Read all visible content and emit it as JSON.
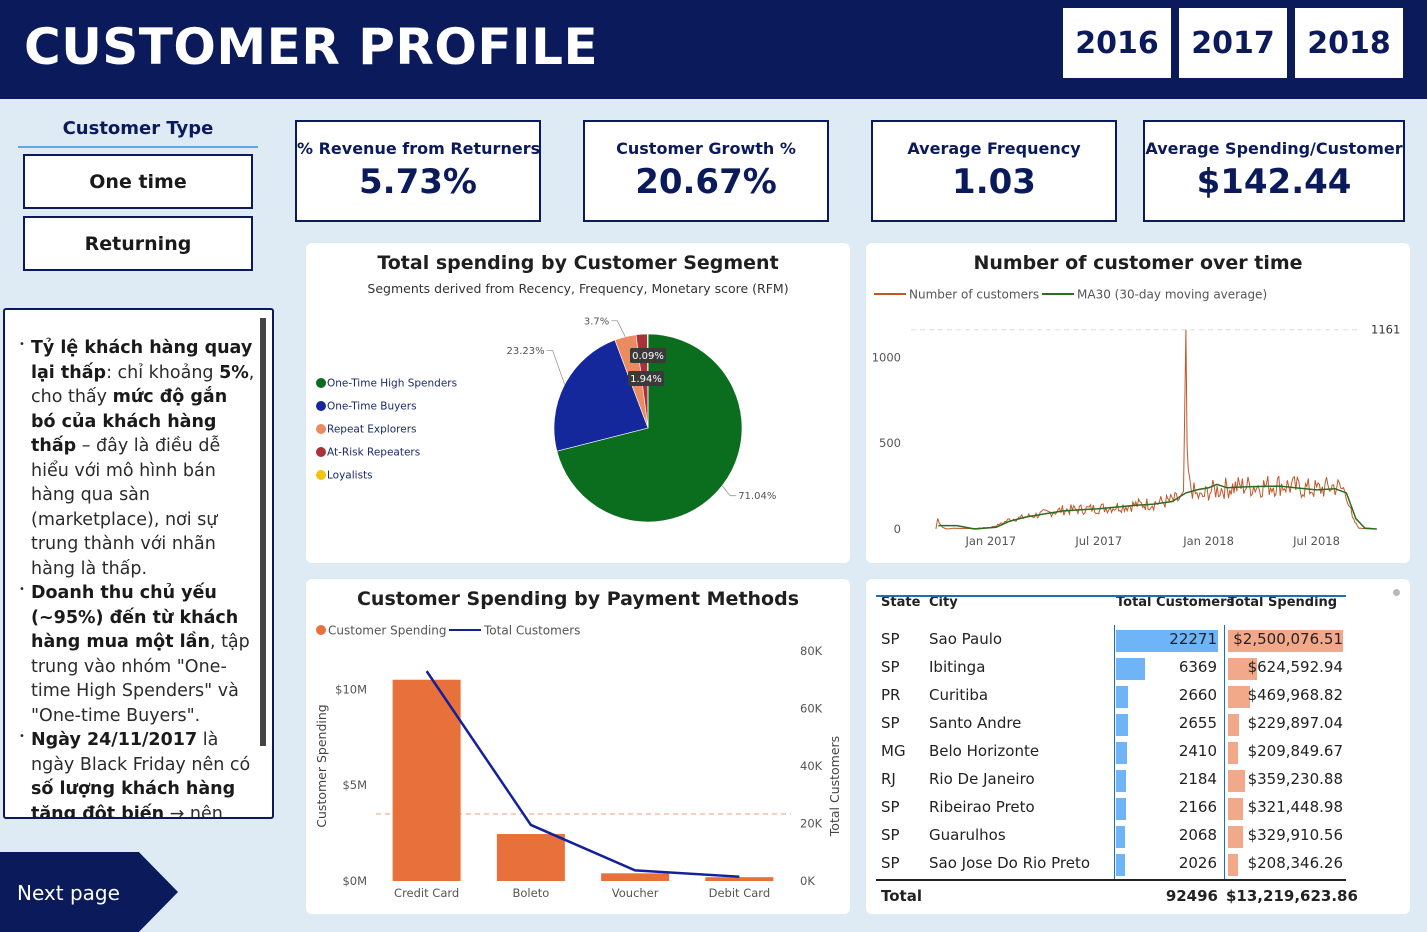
{
  "header": {
    "title": "CUSTOMER PROFILE",
    "years": [
      "2016",
      "2017",
      "2018"
    ]
  },
  "customer_type": {
    "title": "Customer Type",
    "options": [
      "One time",
      "Returning"
    ]
  },
  "kpis": [
    {
      "label": "% Revenue from Returners",
      "value": "5.73%"
    },
    {
      "label": "Customer Growth %",
      "value": "20.67%"
    },
    {
      "label": "Average Frequency",
      "value": "1.03"
    },
    {
      "label": "Average Spending/Customer",
      "value": "$142.44"
    }
  ],
  "notes": [
    {
      "parts": [
        [
          "b",
          "Tỷ lệ khách hàng quay lại thấp"
        ],
        [
          "t",
          ": chỉ khoảng "
        ],
        [
          "b",
          "5%"
        ],
        [
          "t",
          ", cho thấy "
        ],
        [
          "b",
          "mức độ gắn bó của khách hàng thấp"
        ],
        [
          "t",
          " – đây là điều dễ hiểu với mô hình bán hàng qua sàn (marketplace), nơi sự trung thành với nhãn hàng là thấp."
        ]
      ]
    },
    {
      "parts": [
        [
          "b",
          "Doanh thu chủ yếu (~95%) đến từ khách hàng mua một lần"
        ],
        [
          "t",
          ", tập trung vào nhóm \"One-time High Spenders\" và \"One-time Buyers\"."
        ]
      ]
    },
    {
      "parts": [
        [
          "b",
          "Ngày 24/11/2017"
        ],
        [
          "t",
          " là ngày Black Friday nên có "
        ],
        [
          "b",
          "số lượng khách hàng tăng đột biến"
        ],
        [
          "t",
          " → nên tận dụng các sự kiện mua sắm lớn."
        ]
      ]
    }
  ],
  "next_page": "Next page",
  "segment_chart": {
    "title": "Total spending by Customer Segment",
    "subtitle": "Segments derived from Recency, Frequency, Monetary score (RFM)",
    "chart_data": {
      "type": "pie",
      "title": "Total spending by Customer Segment",
      "subtitle": "Segments derived from Recency, Frequency, Monetary score (RFM)",
      "legend_position": "left",
      "slices": [
        {
          "name": "One-Time High Spenders",
          "value": 71.04,
          "label": "71.04%",
          "color": "#0b6e1f"
        },
        {
          "name": "One-Time Buyers",
          "value": 23.23,
          "label": "23.23%",
          "color": "#14279b"
        },
        {
          "name": "Repeat Explorers",
          "value": 3.7,
          "label": "3.7%",
          "color": "#ec8a62"
        },
        {
          "name": "At-Risk Repeaters",
          "value": 1.94,
          "label": "1.94%",
          "color": "#a8323a"
        },
        {
          "name": "Loyalists",
          "value": 0.09,
          "label": "0.09%",
          "color": "#f1c40f"
        }
      ]
    }
  },
  "customers_chart": {
    "title": "Number of customer over time",
    "chart_data": {
      "type": "line",
      "title": "Number of customer over time",
      "series": [
        {
          "name": "Number of customers",
          "color": "#c0582a"
        },
        {
          "name": "MA30 (30-day moving average)",
          "color": "#2e6b22"
        }
      ],
      "x_ticks": [
        "Jan 2017",
        "Jul 2017",
        "Jan 2018",
        "Jul 2018"
      ],
      "y_ticks": [
        "0",
        "500",
        "1000"
      ],
      "ylim": [
        0,
        1200
      ],
      "max_reference": {
        "value": 1161,
        "label": "1161"
      },
      "x_range": [
        "2016-09-01",
        "2018-10-17"
      ],
      "points": [
        [
          "2016-10-01",
          0
        ],
        [
          "2016-10-04",
          60
        ],
        [
          "2016-10-12",
          10
        ],
        [
          "2016-10-20",
          0
        ],
        [
          "2016-11-01",
          5
        ],
        [
          "2016-12-01",
          2
        ],
        [
          "2017-01-01",
          10
        ],
        [
          "2017-01-15",
          25
        ],
        [
          "2017-02-01",
          55
        ],
        [
          "2017-03-01",
          70
        ],
        [
          "2017-04-01",
          90
        ],
        [
          "2017-05-01",
          110
        ],
        [
          "2017-06-01",
          115
        ],
        [
          "2017-07-01",
          120
        ],
        [
          "2017-08-01",
          130
        ],
        [
          "2017-09-01",
          140
        ],
        [
          "2017-10-01",
          150
        ],
        [
          "2017-11-01",
          165
        ],
        [
          "2017-11-20",
          180
        ],
        [
          "2017-11-24",
          1161
        ],
        [
          "2017-11-26",
          380
        ],
        [
          "2017-11-30",
          260
        ],
        [
          "2017-12-10",
          200
        ],
        [
          "2017-12-20",
          180
        ],
        [
          "2018-01-01",
          220
        ],
        [
          "2018-02-01",
          240
        ],
        [
          "2018-03-01",
          250
        ],
        [
          "2018-04-01",
          250
        ],
        [
          "2018-05-01",
          260
        ],
        [
          "2018-06-01",
          240
        ],
        [
          "2018-07-01",
          230
        ],
        [
          "2018-08-01",
          250
        ],
        [
          "2018-08-20",
          220
        ],
        [
          "2018-08-30",
          60
        ],
        [
          "2018-09-10",
          5
        ],
        [
          "2018-10-01",
          0
        ]
      ],
      "ma30": [
        [
          "2016-10-05",
          20
        ],
        [
          "2016-11-05",
          20
        ],
        [
          "2016-12-05",
          0
        ],
        [
          "2017-01-10",
          10
        ],
        [
          "2017-02-01",
          45
        ],
        [
          "2017-03-01",
          70
        ],
        [
          "2017-04-01",
          88
        ],
        [
          "2017-05-01",
          105
        ],
        [
          "2017-06-01",
          112
        ],
        [
          "2017-07-01",
          118
        ],
        [
          "2017-08-01",
          128
        ],
        [
          "2017-09-01",
          138
        ],
        [
          "2017-10-01",
          145
        ],
        [
          "2017-11-01",
          160
        ],
        [
          "2017-11-24",
          210
        ],
        [
          "2017-12-15",
          230
        ],
        [
          "2018-01-01",
          240
        ],
        [
          "2018-01-15",
          260
        ],
        [
          "2018-02-01",
          240
        ],
        [
          "2018-03-01",
          245
        ],
        [
          "2018-04-01",
          248
        ],
        [
          "2018-05-01",
          250
        ],
        [
          "2018-06-01",
          238
        ],
        [
          "2018-07-01",
          228
        ],
        [
          "2018-08-01",
          235
        ],
        [
          "2018-08-20",
          210
        ],
        [
          "2018-09-05",
          60
        ],
        [
          "2018-09-20",
          5
        ],
        [
          "2018-10-10",
          0
        ]
      ]
    }
  },
  "payment_chart": {
    "title": "Customer Spending by Payment Methods",
    "chart_data": {
      "type": "bar",
      "title": "Customer Spending by Payment Methods",
      "categories": [
        "Credit Card",
        "Boleto",
        "Voucher",
        "Debit Card"
      ],
      "series": [
        {
          "name": "Customer Spending",
          "type": "bar",
          "axis": "left",
          "color": "#e8703a",
          "values": [
            10500000,
            2450000,
            400000,
            200000
          ]
        },
        {
          "name": "Total Customers",
          "type": "line",
          "axis": "right",
          "color": "#14209a",
          "values": [
            73000,
            19500,
            3700,
            1500
          ]
        }
      ],
      "ylabel": "Customer Spending",
      "ylabel_right": "Total Customers",
      "y_ticks": [
        "$0M",
        "$5M",
        "$10M"
      ],
      "ylim": [
        0,
        12000000
      ],
      "y2_ticks": [
        "0K",
        "20K",
        "40K",
        "60K",
        "80K"
      ],
      "y2lim": [
        0,
        80000
      ],
      "reference_line": 3500000
    }
  },
  "table": {
    "headers": [
      "State",
      "City",
      "Total Customers",
      "Total Spending"
    ],
    "max_customers": 22271,
    "max_spending": 2500076.51,
    "rows": [
      {
        "state": "SP",
        "city": "Sao Paulo",
        "customers": 22271,
        "customers_label": "22271",
        "spending": 2500076.51,
        "spending_label": "$2,500,076.51"
      },
      {
        "state": "SP",
        "city": "Ibitinga",
        "customers": 6369,
        "customers_label": "6369",
        "spending": 624592.94,
        "spending_label": "$624,592.94"
      },
      {
        "state": "PR",
        "city": "Curitiba",
        "customers": 2660,
        "customers_label": "2660",
        "spending": 469968.82,
        "spending_label": "$469,968.82"
      },
      {
        "state": "SP",
        "city": "Santo Andre",
        "customers": 2655,
        "customers_label": "2655",
        "spending": 229897.04,
        "spending_label": "$229,897.04"
      },
      {
        "state": "MG",
        "city": "Belo Horizonte",
        "customers": 2410,
        "customers_label": "2410",
        "spending": 209849.67,
        "spending_label": "$209,849.67"
      },
      {
        "state": "RJ",
        "city": "Rio De Janeiro",
        "customers": 2184,
        "customers_label": "2184",
        "spending": 359230.88,
        "spending_label": "$359,230.88"
      },
      {
        "state": "SP",
        "city": "Ribeirao Preto",
        "customers": 2166,
        "customers_label": "2166",
        "spending": 321448.98,
        "spending_label": "$321,448.98"
      },
      {
        "state": "SP",
        "city": "Guarulhos",
        "customers": 2068,
        "customers_label": "2068",
        "spending": 329910.56,
        "spending_label": "$329,910.56"
      },
      {
        "state": "SP",
        "city": "Sao Jose Do Rio Preto",
        "customers": 2026,
        "customers_label": "2026",
        "spending": 208346.26,
        "spending_label": "$208,346.26"
      }
    ],
    "total": {
      "label": "Total",
      "customers": "92496",
      "spending": "$13,219,623.86"
    }
  },
  "colors": {
    "navy": "#0b1a5a",
    "background": "#deebf4",
    "bar_blue": "#6fb4f7",
    "bar_salmon": "#f2a98a"
  }
}
